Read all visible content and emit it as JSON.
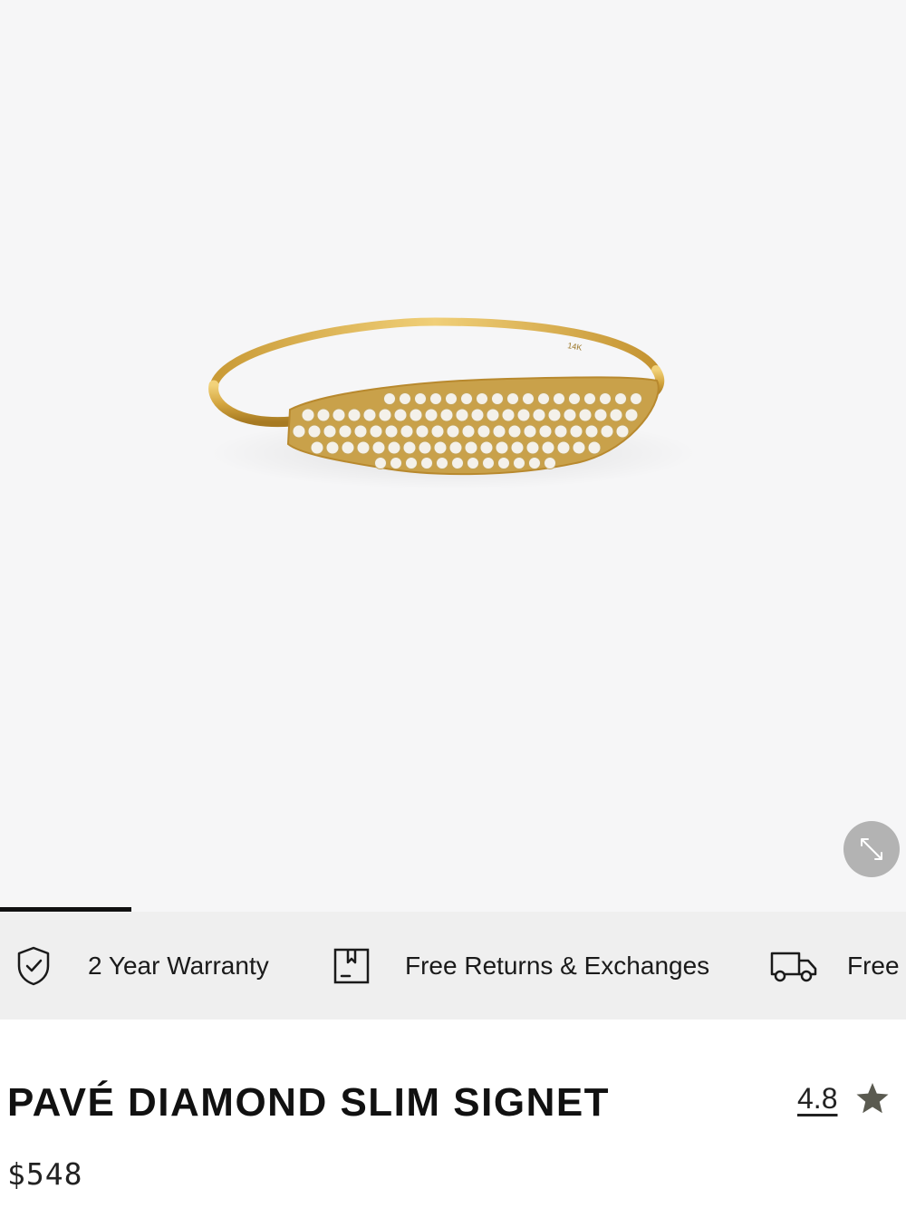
{
  "product": {
    "title": "PAVÉ DIAMOND SLIM SIGNET",
    "price": "$548",
    "rating": "4.8",
    "image_engraving": "14K"
  },
  "gallery": {
    "progress_fraction": 0.145,
    "expand_icon": "expand-arrows-icon",
    "background_color": "#f6f6f7"
  },
  "benefits": [
    {
      "icon": "shield-check-icon",
      "label": "2 Year Warranty"
    },
    {
      "icon": "return-box-icon",
      "label": "Free Returns & Exchanges"
    },
    {
      "icon": "delivery-truck-icon",
      "label": "Free"
    }
  ],
  "colors": {
    "gold": "#d4a640",
    "strip_background": "#efefef",
    "star": "#5a5a50"
  }
}
